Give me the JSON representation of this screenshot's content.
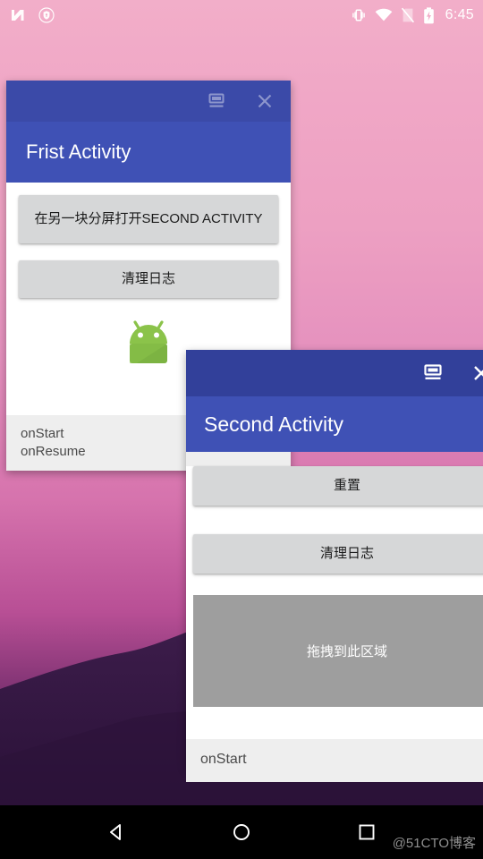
{
  "status_bar": {
    "time": "6:45",
    "left_icons": [
      "android-n-logo-icon",
      "shield-vpn-icon"
    ],
    "right_icons": [
      "vibrate-icon",
      "wifi-icon",
      "no-sim-icon",
      "battery-charging-icon"
    ]
  },
  "windows": [
    {
      "id": "first-activity",
      "title": "Frist Activity",
      "caption_buttons": [
        {
          "name": "split-screen-restore-icon",
          "label": "Restore"
        },
        {
          "name": "close-icon",
          "label": "Close"
        }
      ],
      "buttons": [
        "在另一块分屏打开SECOND ACTIVITY",
        "清理日志"
      ],
      "image": "android-robot-icon",
      "log": "onStart\nonResume"
    },
    {
      "id": "second-activity",
      "title": "Second Activity",
      "caption_buttons": [
        {
          "name": "split-screen-restore-icon",
          "label": "Restore"
        },
        {
          "name": "close-icon",
          "label": "Close"
        }
      ],
      "buttons": [
        "重置",
        "清理日志"
      ],
      "dropzone": "拖拽到此区域",
      "log": "onStart"
    }
  ],
  "nav_bar": {
    "back": "back-icon",
    "home": "home-icon",
    "recents": "recents-icon"
  },
  "watermark": "@51CTO博客",
  "colors": {
    "caption_bar": "#3b4aa8",
    "caption_bar_focused": "#32409a",
    "title_bar": "#3f51b5",
    "button_face": "#d6d7d8",
    "dropzone": "#9e9e9e",
    "log_bg": "#eeeeee",
    "nav_bg": "#000000"
  }
}
